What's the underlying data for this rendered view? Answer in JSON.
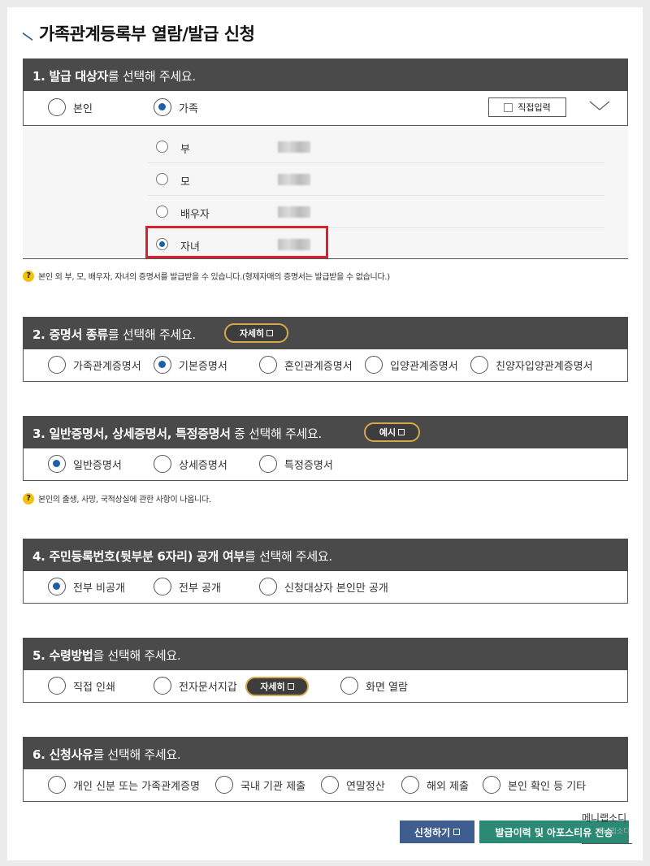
{
  "page_title": "가족관계등록부 열람/발급 신청",
  "section1": {
    "header_bold": "1. 발급 대상자",
    "header_rest": "를 선택해 주세요.",
    "opt_self": "본인",
    "opt_family": "가족",
    "direct_input": "직접입력",
    "family": [
      {
        "label": "부",
        "selected": false
      },
      {
        "label": "모",
        "selected": false
      },
      {
        "label": "배우자",
        "selected": false
      },
      {
        "label": "자녀",
        "selected": true
      }
    ],
    "note": "본인 외 부, 모, 배우자, 자녀의 증명서를 발급받을 수 있습니다.(형제자매의 증명서는 발급받을 수 없습니다.)"
  },
  "section2": {
    "header_bold": "2. 증명서 종류",
    "header_rest": "를 선택해 주세요.",
    "detail_button": "자세히",
    "options": [
      "가족관계증명서",
      "기본증명서",
      "혼인관계증명서",
      "입양관계증명서",
      "친양자입양관계증명서"
    ],
    "selected_index": 1
  },
  "section3": {
    "header_bold": "3. 일반증명서, 상세증명서, 특정증명서",
    "header_rest": " 중 선택해 주세요.",
    "example_button": "예시",
    "options": [
      "일반증명서",
      "상세증명서",
      "특정증명서"
    ],
    "selected_index": 0,
    "note": "본인의 출생, 사망, 국적상실에 관한 사항이 나옵니다."
  },
  "section4": {
    "header_bold": "4. 주민등록번호(뒷부분 6자리) 공개 여부",
    "header_rest": "를 선택해 주세요.",
    "options": [
      "전부 비공개",
      "전부 공개",
      "신청대상자 본인만 공개"
    ],
    "selected_index": 0
  },
  "section5": {
    "header_bold": "5. 수령방법",
    "header_rest": "을 선택해 주세요.",
    "options": [
      "직접 인쇄",
      "전자문서지갑",
      "화면 열람"
    ],
    "detail_button": "자세히",
    "selected_index": -1
  },
  "section6": {
    "header_bold": "6. 신청사유",
    "header_rest": "를 선택해 주세요.",
    "options": [
      "개인 신분 또는 가족관계증명",
      "국내 기관 제출",
      "연말정산",
      "해외 제출",
      "본인 확인 등 기타"
    ],
    "selected_index": -1
  },
  "footer": {
    "apply_button": "신청하기",
    "history_button": "발급이력 및 아포스티유 전송",
    "watermark_line1": "메니랩소디",
    "watermark_line2": "메니랩소디"
  },
  "colors": {
    "section_header": "#4a4a4a",
    "radio_selected": "#1f5fa8",
    "highlight_border": "#d92030",
    "pill_border": "#d3a94a",
    "apply_button": "#3f5d8f",
    "history_button": "#2c8a74"
  }
}
